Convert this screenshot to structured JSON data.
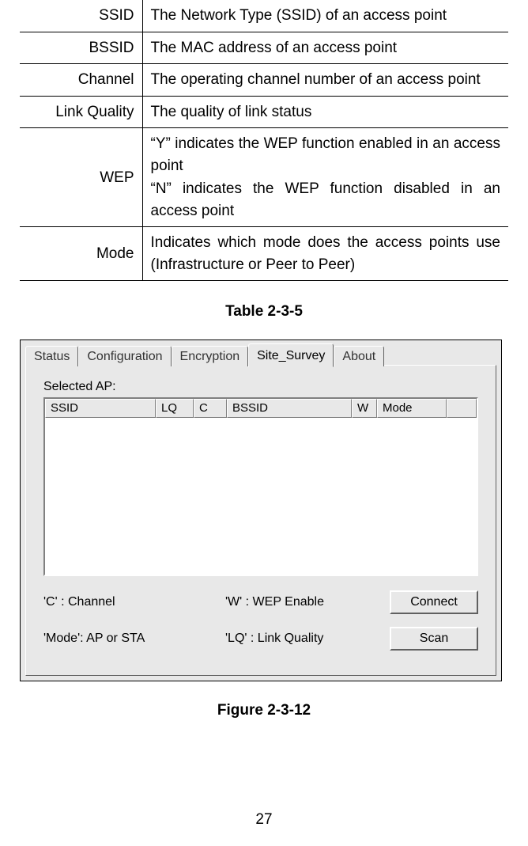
{
  "definitions": {
    "rows": [
      {
        "term": "SSID",
        "desc": "The Network Type (SSID) of an access point"
      },
      {
        "term": "BSSID",
        "desc": "The MAC address of an access point"
      },
      {
        "term": "Channel",
        "desc": "The operating channel number of an access point"
      },
      {
        "term": "Link Quality",
        "desc": "The quality of link status"
      },
      {
        "term": "WEP",
        "desc1": "“Y” indicates the WEP function enabled in an access point",
        "desc2": "“N” indicates the WEP function disabled in an access point"
      },
      {
        "term": "Mode",
        "desc": "Indicates which mode does the access points use (Infrastructure or Peer to Peer)"
      }
    ]
  },
  "captions": {
    "table": "Table 2-3-5",
    "figure": "Figure 2-3-12"
  },
  "dialog": {
    "tabs": {
      "status": "Status",
      "configuration": "Configuration",
      "encryption": "Encryption",
      "site_survey": "Site_Survey",
      "about": "About"
    },
    "selected_ap_label": "Selected AP:",
    "list_headers": {
      "ssid": "SSID",
      "lq": "LQ",
      "c": "C",
      "bssid": "BSSID",
      "w": "W",
      "mode": "Mode"
    },
    "hints": {
      "c": "'C' : Channel",
      "w": "'W' : WEP Enable",
      "mode": "'Mode': AP or STA",
      "lq": "'LQ' : Link Quality"
    },
    "buttons": {
      "connect": "Connect",
      "scan": "Scan"
    }
  },
  "page_number": "27"
}
